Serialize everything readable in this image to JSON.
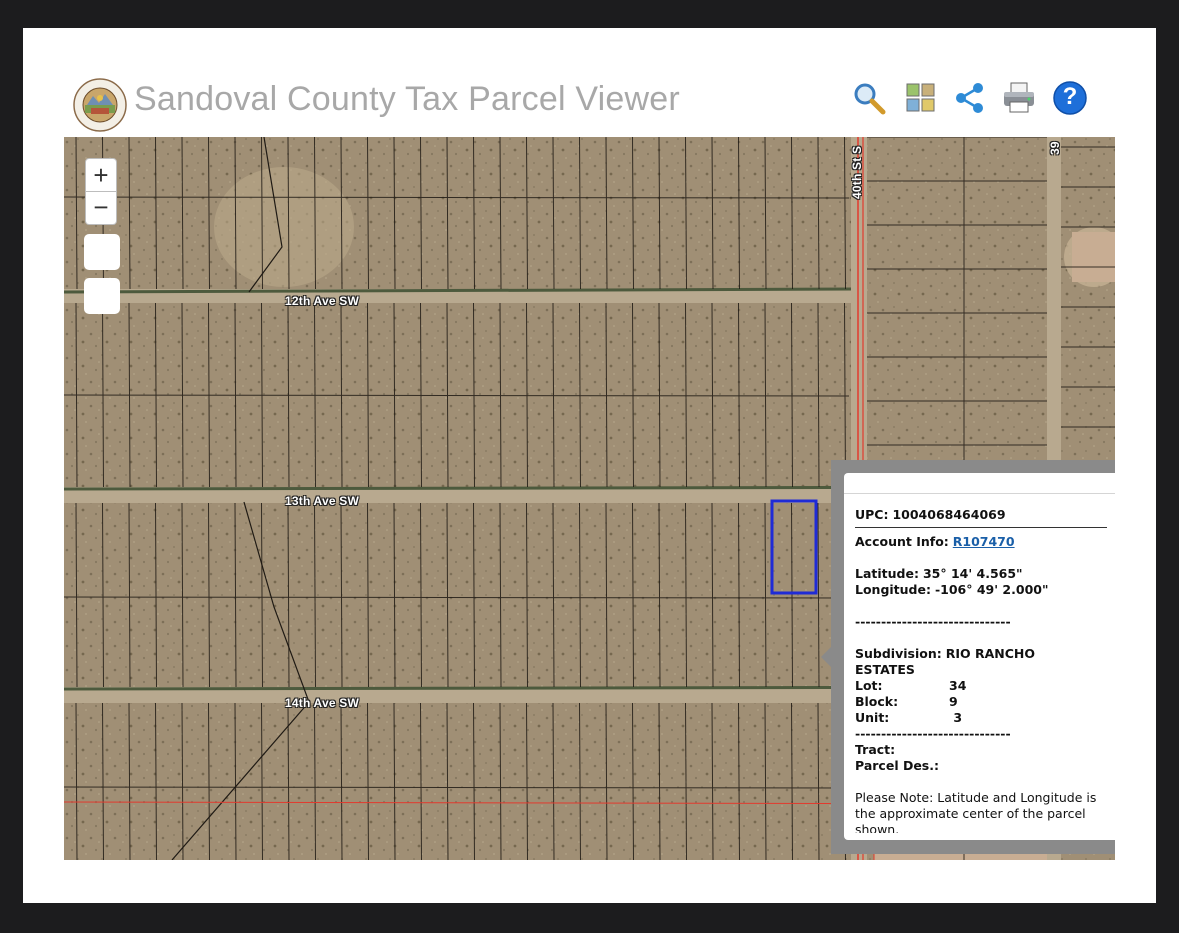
{
  "header": {
    "title": "Sandoval County Tax Parcel Viewer",
    "logo_icon": "county-seal-icon"
  },
  "toolbar": {
    "tools": [
      {
        "name": "search",
        "icon": "magnifier-icon"
      },
      {
        "name": "basemap",
        "icon": "basemap-gallery-icon"
      },
      {
        "name": "share",
        "icon": "share-icon"
      },
      {
        "name": "print",
        "icon": "printer-icon"
      },
      {
        "name": "help",
        "icon": "help-icon",
        "label": "?"
      }
    ]
  },
  "map": {
    "zoom_in": "+",
    "zoom_out": "−",
    "roads": {
      "ave12": "12th Ave SW",
      "ave13": "13th Ave SW",
      "ave14": "14th Ave SW",
      "st40": "40th St S",
      "st39": "39"
    },
    "colors": {
      "terrain": "#a08f75",
      "parcel_line": "#1f1a14",
      "boundary": "#e23a2e",
      "selection": "#1f2bd6"
    }
  },
  "popup": {
    "upc_label": "UPC:",
    "upc_value": "1004068464069",
    "account_label": "Account Info:",
    "account_value": "R107470",
    "latitude_label": "Latitude:",
    "latitude_value": "35° 14' 4.565\"",
    "longitude_label": "Longitude:",
    "longitude_value": "-106° 49' 2.000\"",
    "divider": "------------------------------",
    "subdivision_label": "Subdivision:",
    "subdivision_value_1": "RIO RANCHO",
    "subdivision_value_2": "ESTATES",
    "lot_label": "Lot:",
    "lot_value": "34",
    "block_label": "Block:",
    "block_value": "9",
    "unit_label": "Unit:",
    "unit_value": " 3",
    "tract_label": "Tract:",
    "parcel_des_label": "Parcel Des.:",
    "note_1": "Please Note: Latitude and Longitude is",
    "note_2": "the approximate center of the parcel",
    "note_3": "shown."
  }
}
